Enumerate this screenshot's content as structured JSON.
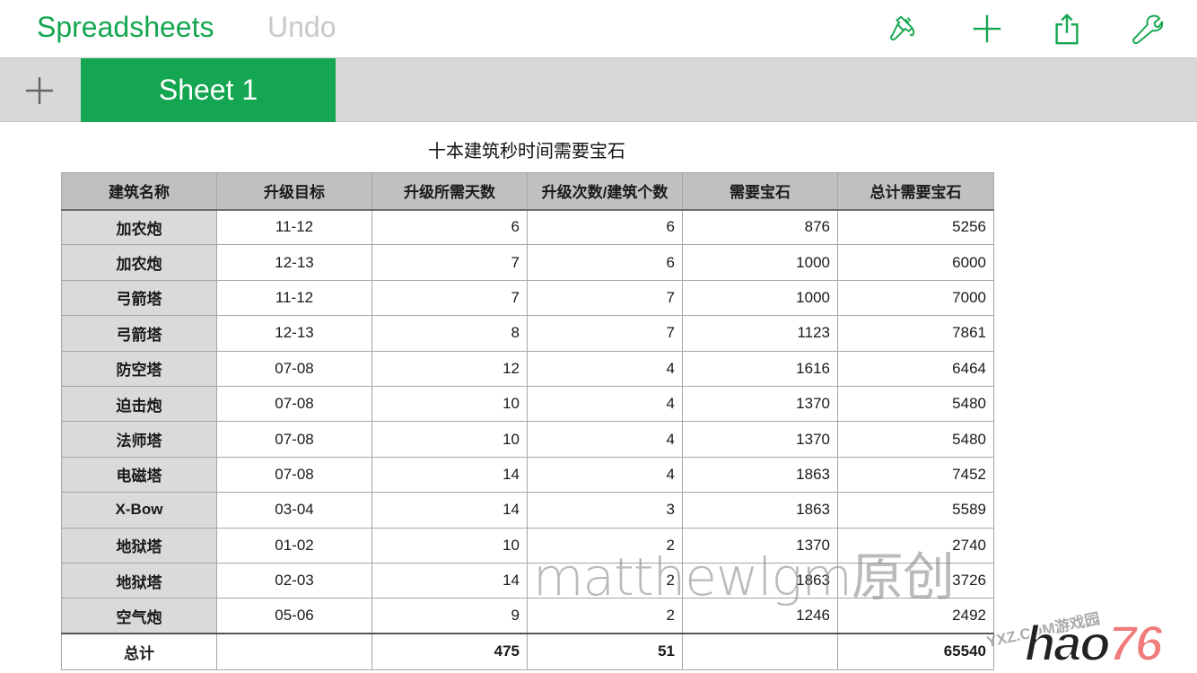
{
  "app": {
    "title": "Spreadsheets",
    "undo_label": "Undo",
    "accent_color": "#14a650"
  },
  "toolbar": {
    "icons": [
      "paintbrush-icon",
      "plus-icon",
      "share-icon",
      "wrench-icon"
    ]
  },
  "tabs": {
    "add_icon": "plus-icon",
    "sheets": [
      {
        "label": "Sheet 1",
        "active": true
      }
    ]
  },
  "table": {
    "title": "十本建筑秒时间需要宝石",
    "headers": [
      "建筑名称",
      "升级目标",
      "升级所需天数",
      "升级次数/建筑个数",
      "需要宝石",
      "总计需要宝石"
    ],
    "rows": [
      [
        "加农炮",
        "11-12",
        "6",
        "6",
        "876",
        "5256"
      ],
      [
        "加农炮",
        "12-13",
        "7",
        "6",
        "1000",
        "6000"
      ],
      [
        "弓箭塔",
        "11-12",
        "7",
        "7",
        "1000",
        "7000"
      ],
      [
        "弓箭塔",
        "12-13",
        "8",
        "7",
        "1123",
        "7861"
      ],
      [
        "防空塔",
        "07-08",
        "12",
        "4",
        "1616",
        "6464"
      ],
      [
        "迫击炮",
        "07-08",
        "10",
        "4",
        "1370",
        "5480"
      ],
      [
        "法师塔",
        "07-08",
        "10",
        "4",
        "1370",
        "5480"
      ],
      [
        "电磁塔",
        "07-08",
        "14",
        "4",
        "1863",
        "7452"
      ],
      [
        "X-Bow",
        "03-04",
        "14",
        "3",
        "1863",
        "5589"
      ],
      [
        "地狱塔",
        "01-02",
        "10",
        "2",
        "1370",
        "2740"
      ],
      [
        "地狱塔",
        "02-03",
        "14",
        "2",
        "1863",
        "3726"
      ],
      [
        "空气炮",
        "05-06",
        "9",
        "2",
        "1246",
        "2492"
      ]
    ],
    "total": [
      "总计",
      "",
      "475",
      "51",
      "",
      "65540"
    ]
  },
  "overlay": {
    "watermark": "matthewlgm原创",
    "logo_small": "YXZ.COM游戏园",
    "logo_text": "hao",
    "logo_num": "76"
  }
}
